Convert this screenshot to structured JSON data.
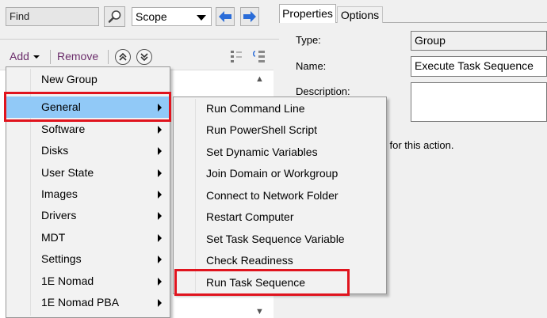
{
  "toolbar_top": {
    "find_value": "Find",
    "scope_value": "Scope",
    "icons": [
      "magnifier-icon",
      "arrow-left-icon",
      "arrow-right-icon"
    ],
    "nav_color": "#2a6cd8"
  },
  "toolbar": {
    "add_label": "Add",
    "remove_label": "Remove"
  },
  "tabs": [
    {
      "label": "Properties",
      "active": true
    },
    {
      "label": "Options",
      "active": false
    }
  ],
  "properties": {
    "type_label": "Type:",
    "type_value": "Group",
    "name_label": "Name:",
    "name_value": "Execute Task Sequence",
    "description_label": "Description:",
    "description_value": "",
    "info_text": "uired  for this action."
  },
  "add_menu": {
    "items": [
      {
        "label": "New Group",
        "submenu": false
      },
      {
        "label": "General",
        "submenu": true,
        "highlighted": true
      },
      {
        "label": "Software",
        "submenu": true
      },
      {
        "label": "Disks",
        "submenu": true
      },
      {
        "label": "User State",
        "submenu": true
      },
      {
        "label": "Images",
        "submenu": true
      },
      {
        "label": "Drivers",
        "submenu": true
      },
      {
        "label": "MDT",
        "submenu": true
      },
      {
        "label": "Settings",
        "submenu": true
      },
      {
        "label": "1E Nomad",
        "submenu": true
      },
      {
        "label": "1E Nomad PBA",
        "submenu": true
      }
    ]
  },
  "general_submenu": {
    "items": [
      {
        "label": "Run Command Line"
      },
      {
        "label": "Run PowerShell Script"
      },
      {
        "label": "Set Dynamic Variables"
      },
      {
        "label": "Join Domain or Workgroup"
      },
      {
        "label": "Connect to Network Folder"
      },
      {
        "label": "Restart Computer"
      },
      {
        "label": "Set Task Sequence Variable"
      },
      {
        "label": "Check Readiness"
      },
      {
        "label": "Run Task Sequence",
        "callout": true
      }
    ]
  },
  "colors": {
    "highlight": "#91c9f7",
    "callout_red": "#e0141e",
    "toolbar_text": "#6b2d6b"
  }
}
